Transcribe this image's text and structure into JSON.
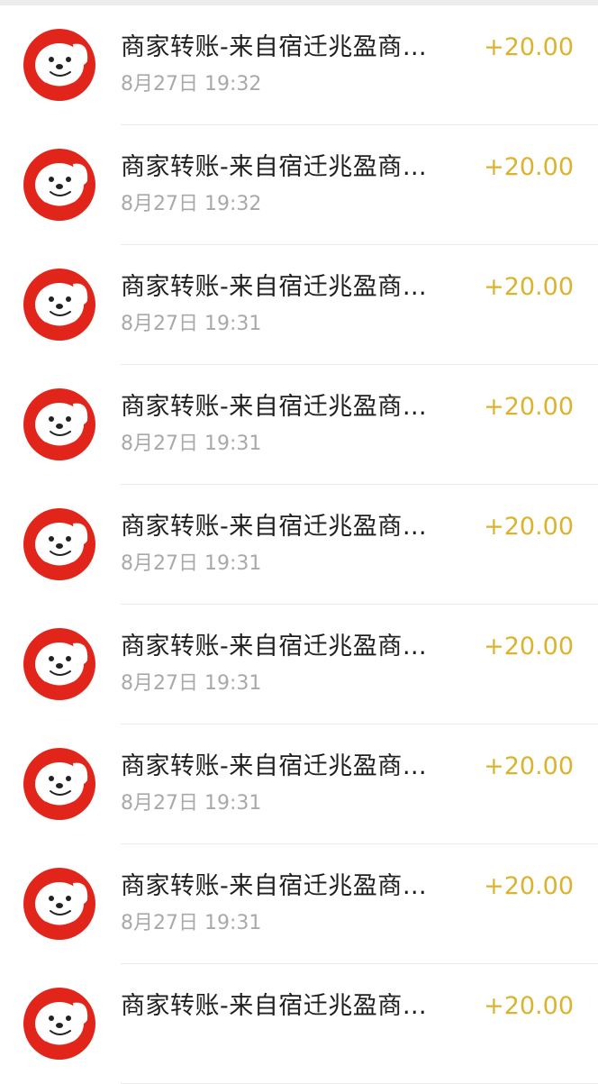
{
  "transactions": [
    {
      "title": "商家转账-来自宿迁兆盈商…",
      "time": "8月27日 19:32",
      "amount": "+20.00"
    },
    {
      "title": "商家转账-来自宿迁兆盈商…",
      "time": "8月27日 19:32",
      "amount": "+20.00"
    },
    {
      "title": "商家转账-来自宿迁兆盈商…",
      "time": "8月27日 19:31",
      "amount": "+20.00"
    },
    {
      "title": "商家转账-来自宿迁兆盈商…",
      "time": "8月27日 19:31",
      "amount": "+20.00"
    },
    {
      "title": "商家转账-来自宿迁兆盈商…",
      "time": "8月27日 19:31",
      "amount": "+20.00"
    },
    {
      "title": "商家转账-来自宿迁兆盈商…",
      "time": "8月27日 19:31",
      "amount": "+20.00"
    },
    {
      "title": "商家转账-来自宿迁兆盈商…",
      "time": "8月27日 19:31",
      "amount": "+20.00"
    },
    {
      "title": "商家转账-来自宿迁兆盈商…",
      "time": "8月27日 19:31",
      "amount": "+20.00"
    },
    {
      "title": "商家转账-来自宿迁兆盈商…",
      "time": "",
      "amount": "+20.00"
    }
  ],
  "avatar_icon": "jd-dog-mascot-icon",
  "colors": {
    "amount": "#dcb32e",
    "avatar_red": "#e1251b",
    "title": "#1f1f1f",
    "time": "#a9a9a9"
  }
}
